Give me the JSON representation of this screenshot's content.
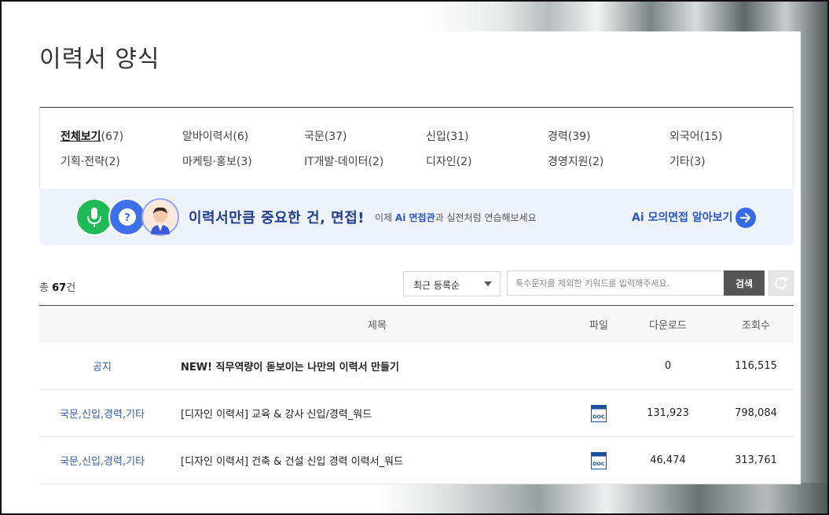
{
  "page": {
    "title": "이력서 양식"
  },
  "categories": [
    {
      "name": "전체보기",
      "count": "(67)",
      "active": true
    },
    {
      "name": "알바이력서",
      "count": "(6)"
    },
    {
      "name": "국문",
      "count": "(37)"
    },
    {
      "name": "신입",
      "count": "(31)"
    },
    {
      "name": "경력",
      "count": "(39)"
    },
    {
      "name": "외국어",
      "count": "(15)"
    },
    {
      "name": "기획·전략",
      "count": "(2)"
    },
    {
      "name": "마케팅·홍보",
      "count": "(3)"
    },
    {
      "name": "IT개발·데이터",
      "count": "(2)"
    },
    {
      "name": "디자인",
      "count": "(2)"
    },
    {
      "name": "경영지원",
      "count": "(2)"
    },
    {
      "name": "기타",
      "count": "(3)"
    }
  ],
  "banner": {
    "main": "이력서만큼 중요한 건, 면접!",
    "sub_pre": "이제 ",
    "sub_bold": "Ai 면접관",
    "sub_post": "과 실전처럼 연습해보세요",
    "link_bold": "Ai 모의면접",
    "link_rest": " 알아보기"
  },
  "controls": {
    "total_pre": "총 ",
    "total_count": "67",
    "total_post": "건",
    "sort_selected": "최근 등록순",
    "search_placeholder": "특수문자를 제외한 키워드를 입력해주세요.",
    "search_button": "검색"
  },
  "table": {
    "headers": {
      "title": "제목",
      "file": "파일",
      "downloads": "다운로드",
      "views": "조회수"
    },
    "rows": [
      {
        "category": "공지",
        "title": "NEW! 직무역량이 돋보이는 나만의 이력서 만들기",
        "file": "",
        "downloads": "0",
        "views": "116,515"
      },
      {
        "category": "국문,신입,경력,기타",
        "title": "[디자인 이력서] 교육 & 강사 신입/경력_워드",
        "file": "doc-icon",
        "downloads": "131,923",
        "views": "798,084"
      },
      {
        "category": "국문,신입,경력,기타",
        "title": "[디자인 이력서] 건축 & 건설 신입 경력 이력서_워드",
        "file": "doc-icon",
        "downloads": "46,474",
        "views": "313,761"
      }
    ]
  },
  "colors": {
    "accent": "#2a56c6",
    "banner_bg": "#eef3fb",
    "link_blue": "#2f5fb8",
    "mic_green": "#1fba55"
  }
}
